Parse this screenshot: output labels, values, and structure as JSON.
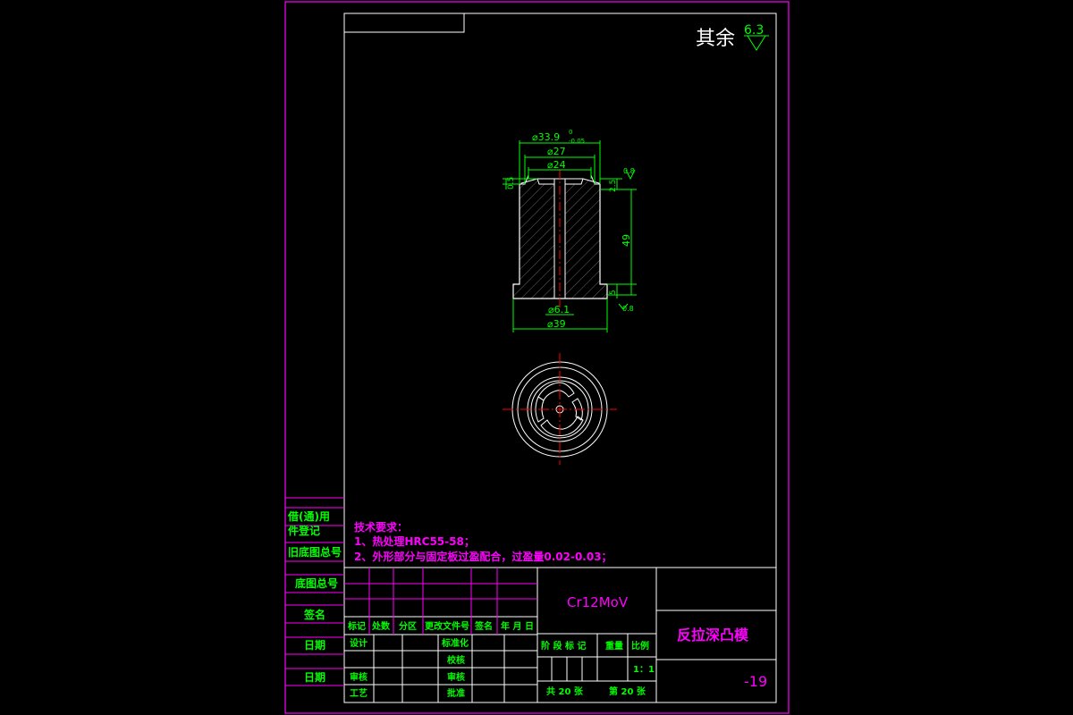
{
  "colors": {
    "frame": "#ff00ff",
    "drawing": "#00ff00",
    "center": "#ff0000",
    "white": "#ffffff",
    "note": "#ff00ff",
    "table_text": "#00ff00"
  },
  "roughness": {
    "prefix": "其余",
    "value": "6.3"
  },
  "dimensions": {
    "d_outer_top": "⌀33.9",
    "d_outer_top_tol_upper": "0",
    "d_outer_top_tol_lower": "-0.05",
    "d27": "⌀27",
    "d24": "⌀24",
    "d61": "⌀6.1",
    "d39": "⌀39",
    "h05": "0.5",
    "h25": "2.5",
    "h49": "49",
    "h5": "5",
    "r08_top": "0.8",
    "r08_bottom": "0.8"
  },
  "notes": {
    "title": "技术要求：",
    "line1": "1、热处理HRC55-58；",
    "line2": "2、外形部分与固定板过盈配合，过盈量0.02-0.03；"
  },
  "left_strip": {
    "c1": "借(通)用",
    "c2": "件登记",
    "c3": "旧底图总号",
    "c4": "底图总号",
    "c5": "签名",
    "c6": "日期",
    "c7": "日期"
  },
  "title_block": {
    "material": "Cr12MoV",
    "part_name": "反拉深凸模",
    "drawing_no": "-19",
    "rev_headers": [
      "标记",
      "处数",
      "分区",
      "更改文件号",
      "签名",
      "年 月 日"
    ],
    "design": "设计",
    "standardize": "标准化",
    "check": "审核",
    "process": "工艺",
    "proofread": "校核",
    "approve": "批准",
    "review": "审核",
    "stage_headers": [
      "阶 段 标 记",
      "重量",
      "比例"
    ],
    "scale": "1：1",
    "sheets_total": "共 20 张",
    "sheet_no": "第 20 张"
  }
}
